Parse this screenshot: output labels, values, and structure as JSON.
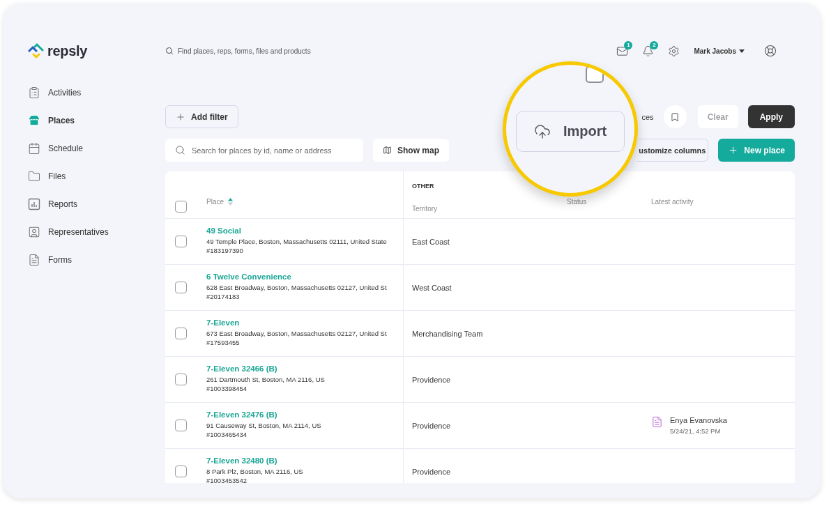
{
  "logo": {
    "text": "repsly"
  },
  "global_search": {
    "placeholder": "Find places, reps, forms, files and products"
  },
  "header": {
    "mail_badge": "1",
    "notification_badge": "2",
    "user": "Mark Jacobs"
  },
  "sidebar": {
    "items": [
      {
        "label": "Activities",
        "kind": "activities",
        "selected": false
      },
      {
        "label": "Places",
        "kind": "places",
        "selected": true
      },
      {
        "label": "Schedule",
        "kind": "schedule",
        "selected": false
      },
      {
        "label": "Files",
        "kind": "files",
        "selected": false
      },
      {
        "label": "Reports",
        "kind": "reports",
        "selected": false
      },
      {
        "label": "Representatives",
        "kind": "representatives",
        "selected": false
      },
      {
        "label": "Forms",
        "kind": "forms",
        "selected": false
      }
    ]
  },
  "toolbar": {
    "add_filter": "Add filter",
    "places_partial": "ces",
    "clear": {
      "label": "Clear",
      "disabled": true
    },
    "apply": "Apply",
    "search": {
      "placeholder": "Search for places by id, name or address"
    },
    "show_map": "Show map",
    "customize_columns_partial": "ustomize columns",
    "new_place": "New place"
  },
  "table": {
    "group_label": "OTHER",
    "columns": [
      {
        "label": "Place",
        "sortable": true
      },
      {
        "label": "Territory",
        "sortable": false
      },
      {
        "label": "Status",
        "sortable": false
      },
      {
        "label": "Latest activity",
        "sortable": false
      }
    ],
    "header_checked": false,
    "rows": [
      {
        "name": "49 Social",
        "address": "49 Temple Place, Boston, Massachusetts 02111, United State",
        "id": "#183197390",
        "territory": "East Coast",
        "checked": false
      },
      {
        "name": "6 Twelve Convenience",
        "address": "628 East Broadway, Boston, Massachusetts 02127, United St",
        "id": "#20174183",
        "territory": "West Coast",
        "checked": false
      },
      {
        "name": "7-Eleven",
        "address": "673 East Broadway, Boston, Massachusetts 02127, United St",
        "id": "#17593455",
        "territory": "Merchandising Team",
        "checked": false
      },
      {
        "name": "7-Eleven 32466 (B)",
        "address": "261 Dartmouth St, Boston, MA 2116, US",
        "id": "#1003398454",
        "territory": "Providence",
        "checked": false
      },
      {
        "name": "7-Eleven 32476 (B)",
        "address": "91 Causeway St, Boston, MA 2114, US",
        "id": "#1003465434",
        "territory": "Providence",
        "checked": false,
        "activity": {
          "rep": "Enya Evanovska",
          "time": "5/24/21, 4:52 PM"
        }
      },
      {
        "name": "7-Eleven 32480 (B)",
        "address": "8 Park Plz, Boston, MA 2116, US",
        "id": "#1003453542",
        "territory": "Providence",
        "checked": false
      }
    ]
  },
  "callout": {
    "import": "Import",
    "checkbox_checked": false
  }
}
